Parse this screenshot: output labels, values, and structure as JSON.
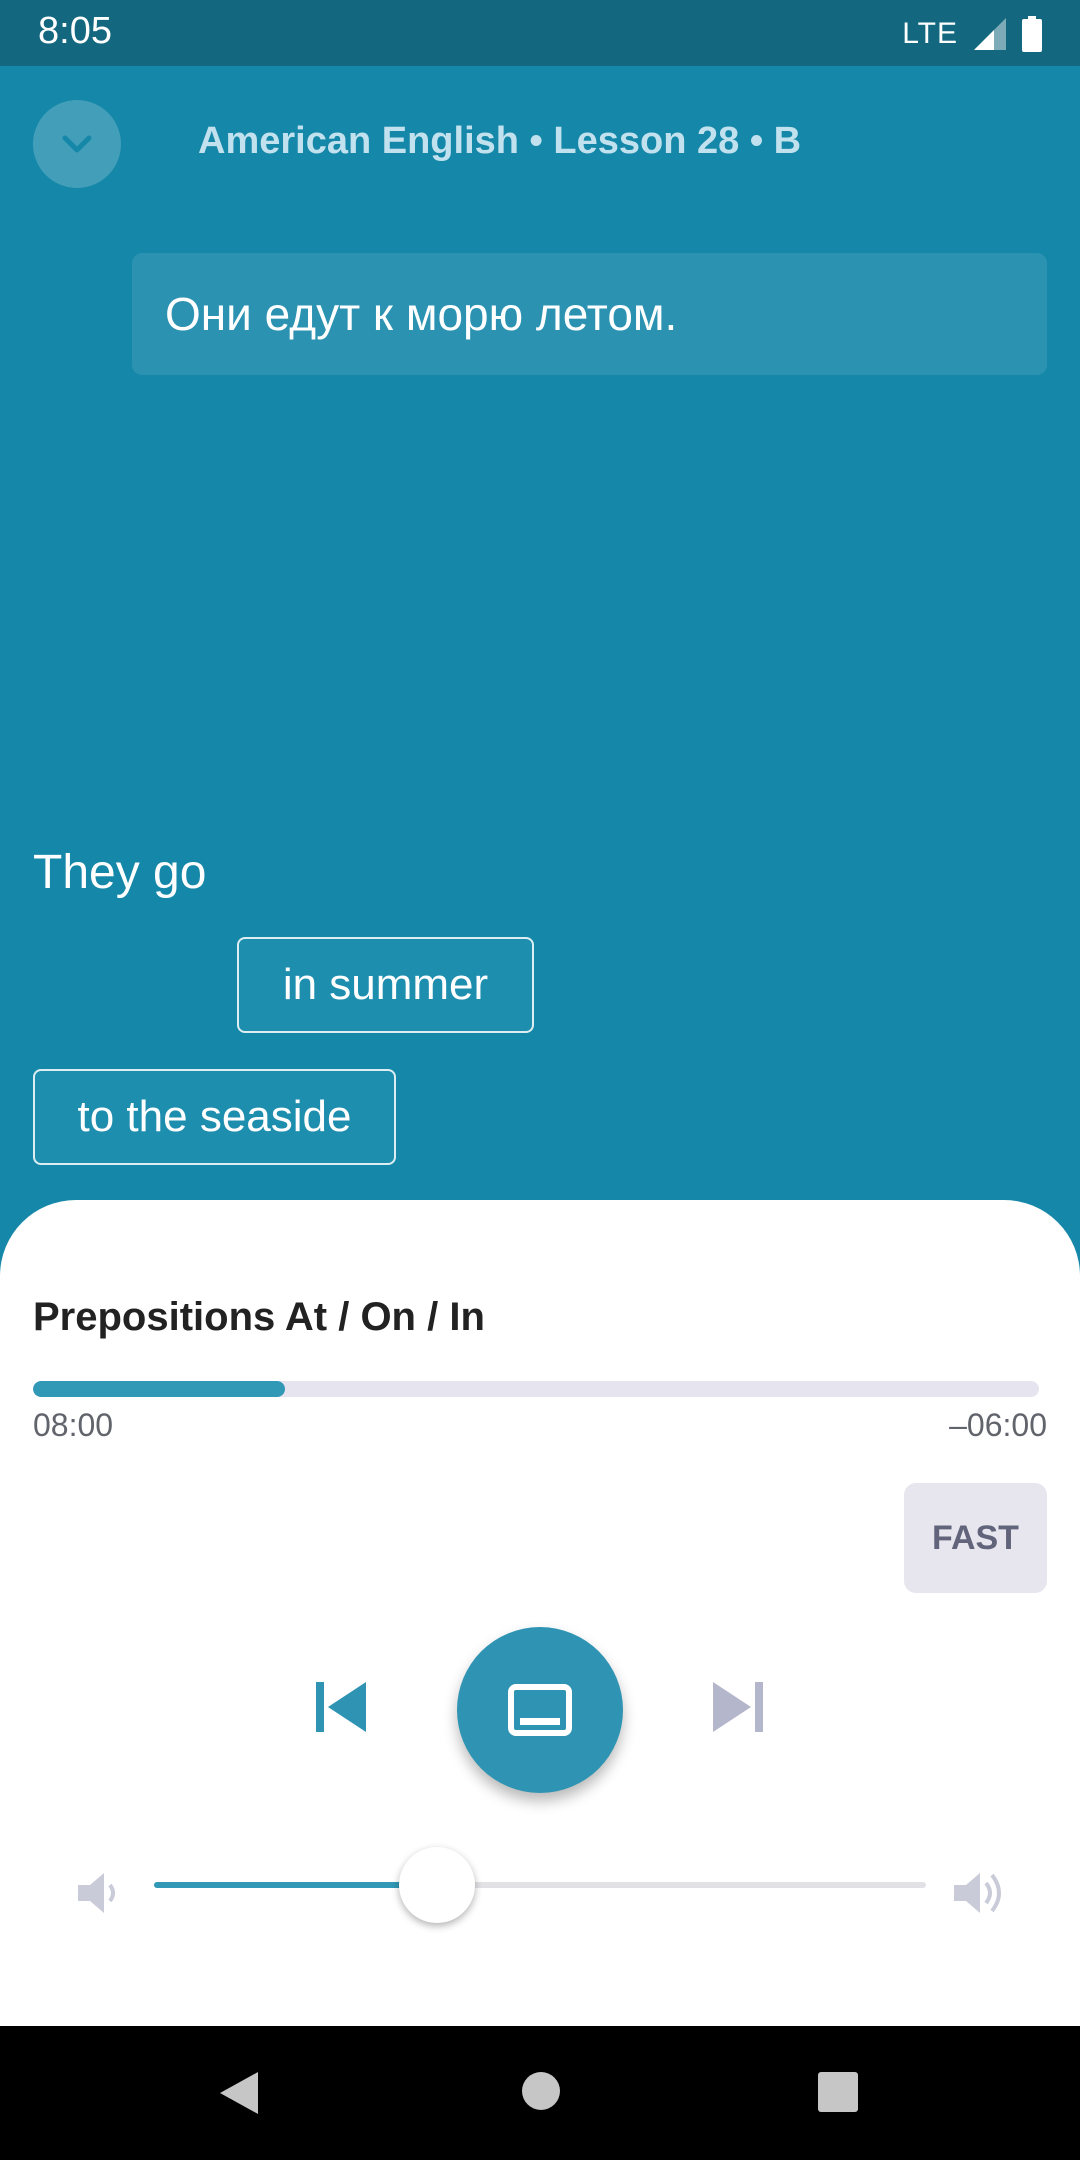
{
  "status_bar": {
    "time": "8:05",
    "network": "LTE"
  },
  "header": {
    "lesson_title": "American English • Lesson 28 • B",
    "collapse_icon": "chevron-down-icon"
  },
  "prompt": {
    "text": "Они едут к морю летом."
  },
  "answer": {
    "text": "They go"
  },
  "word_chips": [
    {
      "label": "in summer"
    },
    {
      "label": "to the seaside"
    }
  ],
  "player": {
    "track_title": "Prepositions At / On / In",
    "progress_fraction": 0.25,
    "elapsed": "08:00",
    "remaining": "–06:00",
    "speed_label": "FAST",
    "volume_fraction": 0.366
  },
  "colors": {
    "background": "#1587a8",
    "status_bar": "#13687f",
    "accent": "#3198b6",
    "sheet": "#ffffff"
  },
  "icons": {
    "prev": "skip-previous-icon",
    "play": "subtitles-icon",
    "next": "skip-next-icon",
    "volume_low": "volume-low-icon",
    "volume_high": "volume-high-icon",
    "nav_back": "nav-back-icon",
    "nav_home": "nav-home-icon",
    "nav_recents": "nav-recents-icon"
  }
}
